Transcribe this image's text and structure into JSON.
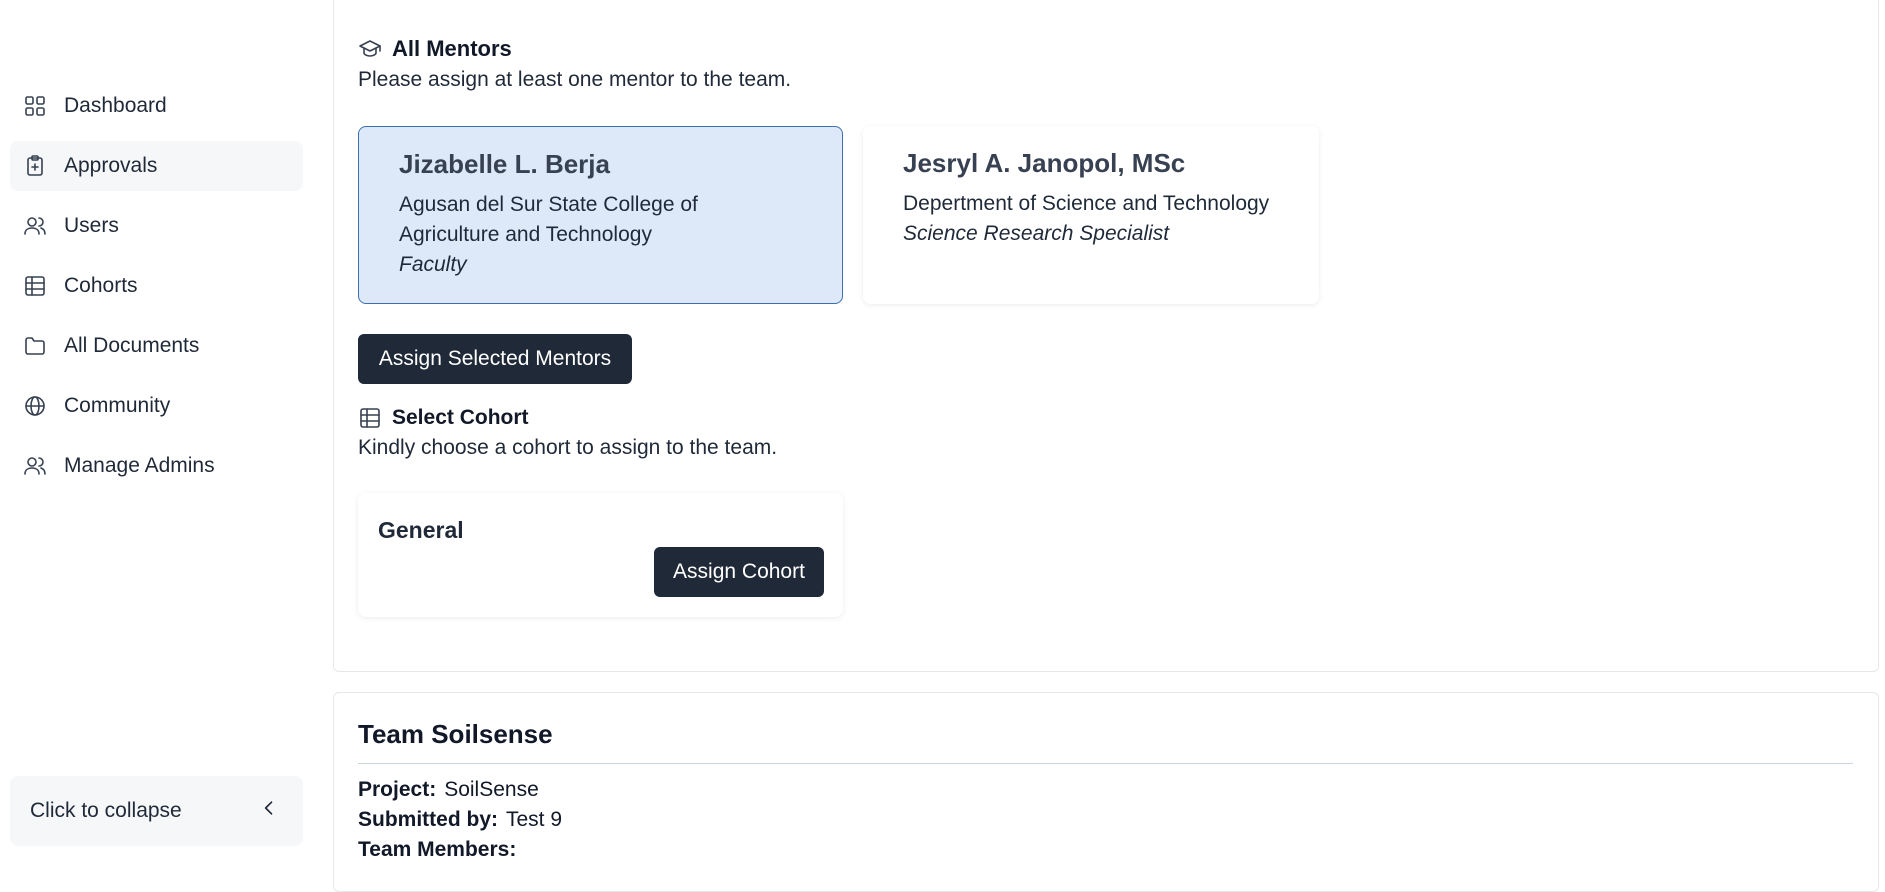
{
  "sidebar": {
    "items": [
      {
        "label": "Dashboard",
        "icon": "grid-icon"
      },
      {
        "label": "Approvals",
        "icon": "clipboard-plus-icon"
      },
      {
        "label": "Users",
        "icon": "users-icon"
      },
      {
        "label": "Cohorts",
        "icon": "table-icon"
      },
      {
        "label": "All Documents",
        "icon": "folder-icon"
      },
      {
        "label": "Community",
        "icon": "globe-icon"
      },
      {
        "label": "Manage Admins",
        "icon": "users-icon"
      }
    ],
    "active_index": 1,
    "collapse_label": "Click to collapse"
  },
  "mentors": {
    "title": "All Mentors",
    "subtitle": "Please assign at least one mentor to the team.",
    "cards": [
      {
        "name": "Jizabelle L. Berja",
        "org_line1": "Agusan del Sur State College of",
        "org_line2": "Agriculture and Technology",
        "role": "Faculty",
        "selected": true
      },
      {
        "name": "Jesryl A. Janopol, MSc",
        "org_line1": "Depertment of Science and Technology",
        "role": "Science Research Specialist",
        "selected": false
      }
    ],
    "assign_button": "Assign Selected Mentors"
  },
  "cohort": {
    "title": "Select Cohort",
    "subtitle": "Kindly choose a cohort to assign to the team.",
    "cards": [
      {
        "name": "General",
        "button": "Assign Cohort"
      }
    ]
  },
  "team": {
    "title": "Team Soilsense",
    "project_label": "Project:",
    "project_value": "SoilSense",
    "submitted_label": "Submitted by:",
    "submitted_value": "Test 9",
    "members_label": "Team Members:"
  },
  "colors": {
    "accent_dark": "#1f2937",
    "selected_bg": "#dde9f8",
    "selected_border": "#3b6fb0"
  }
}
